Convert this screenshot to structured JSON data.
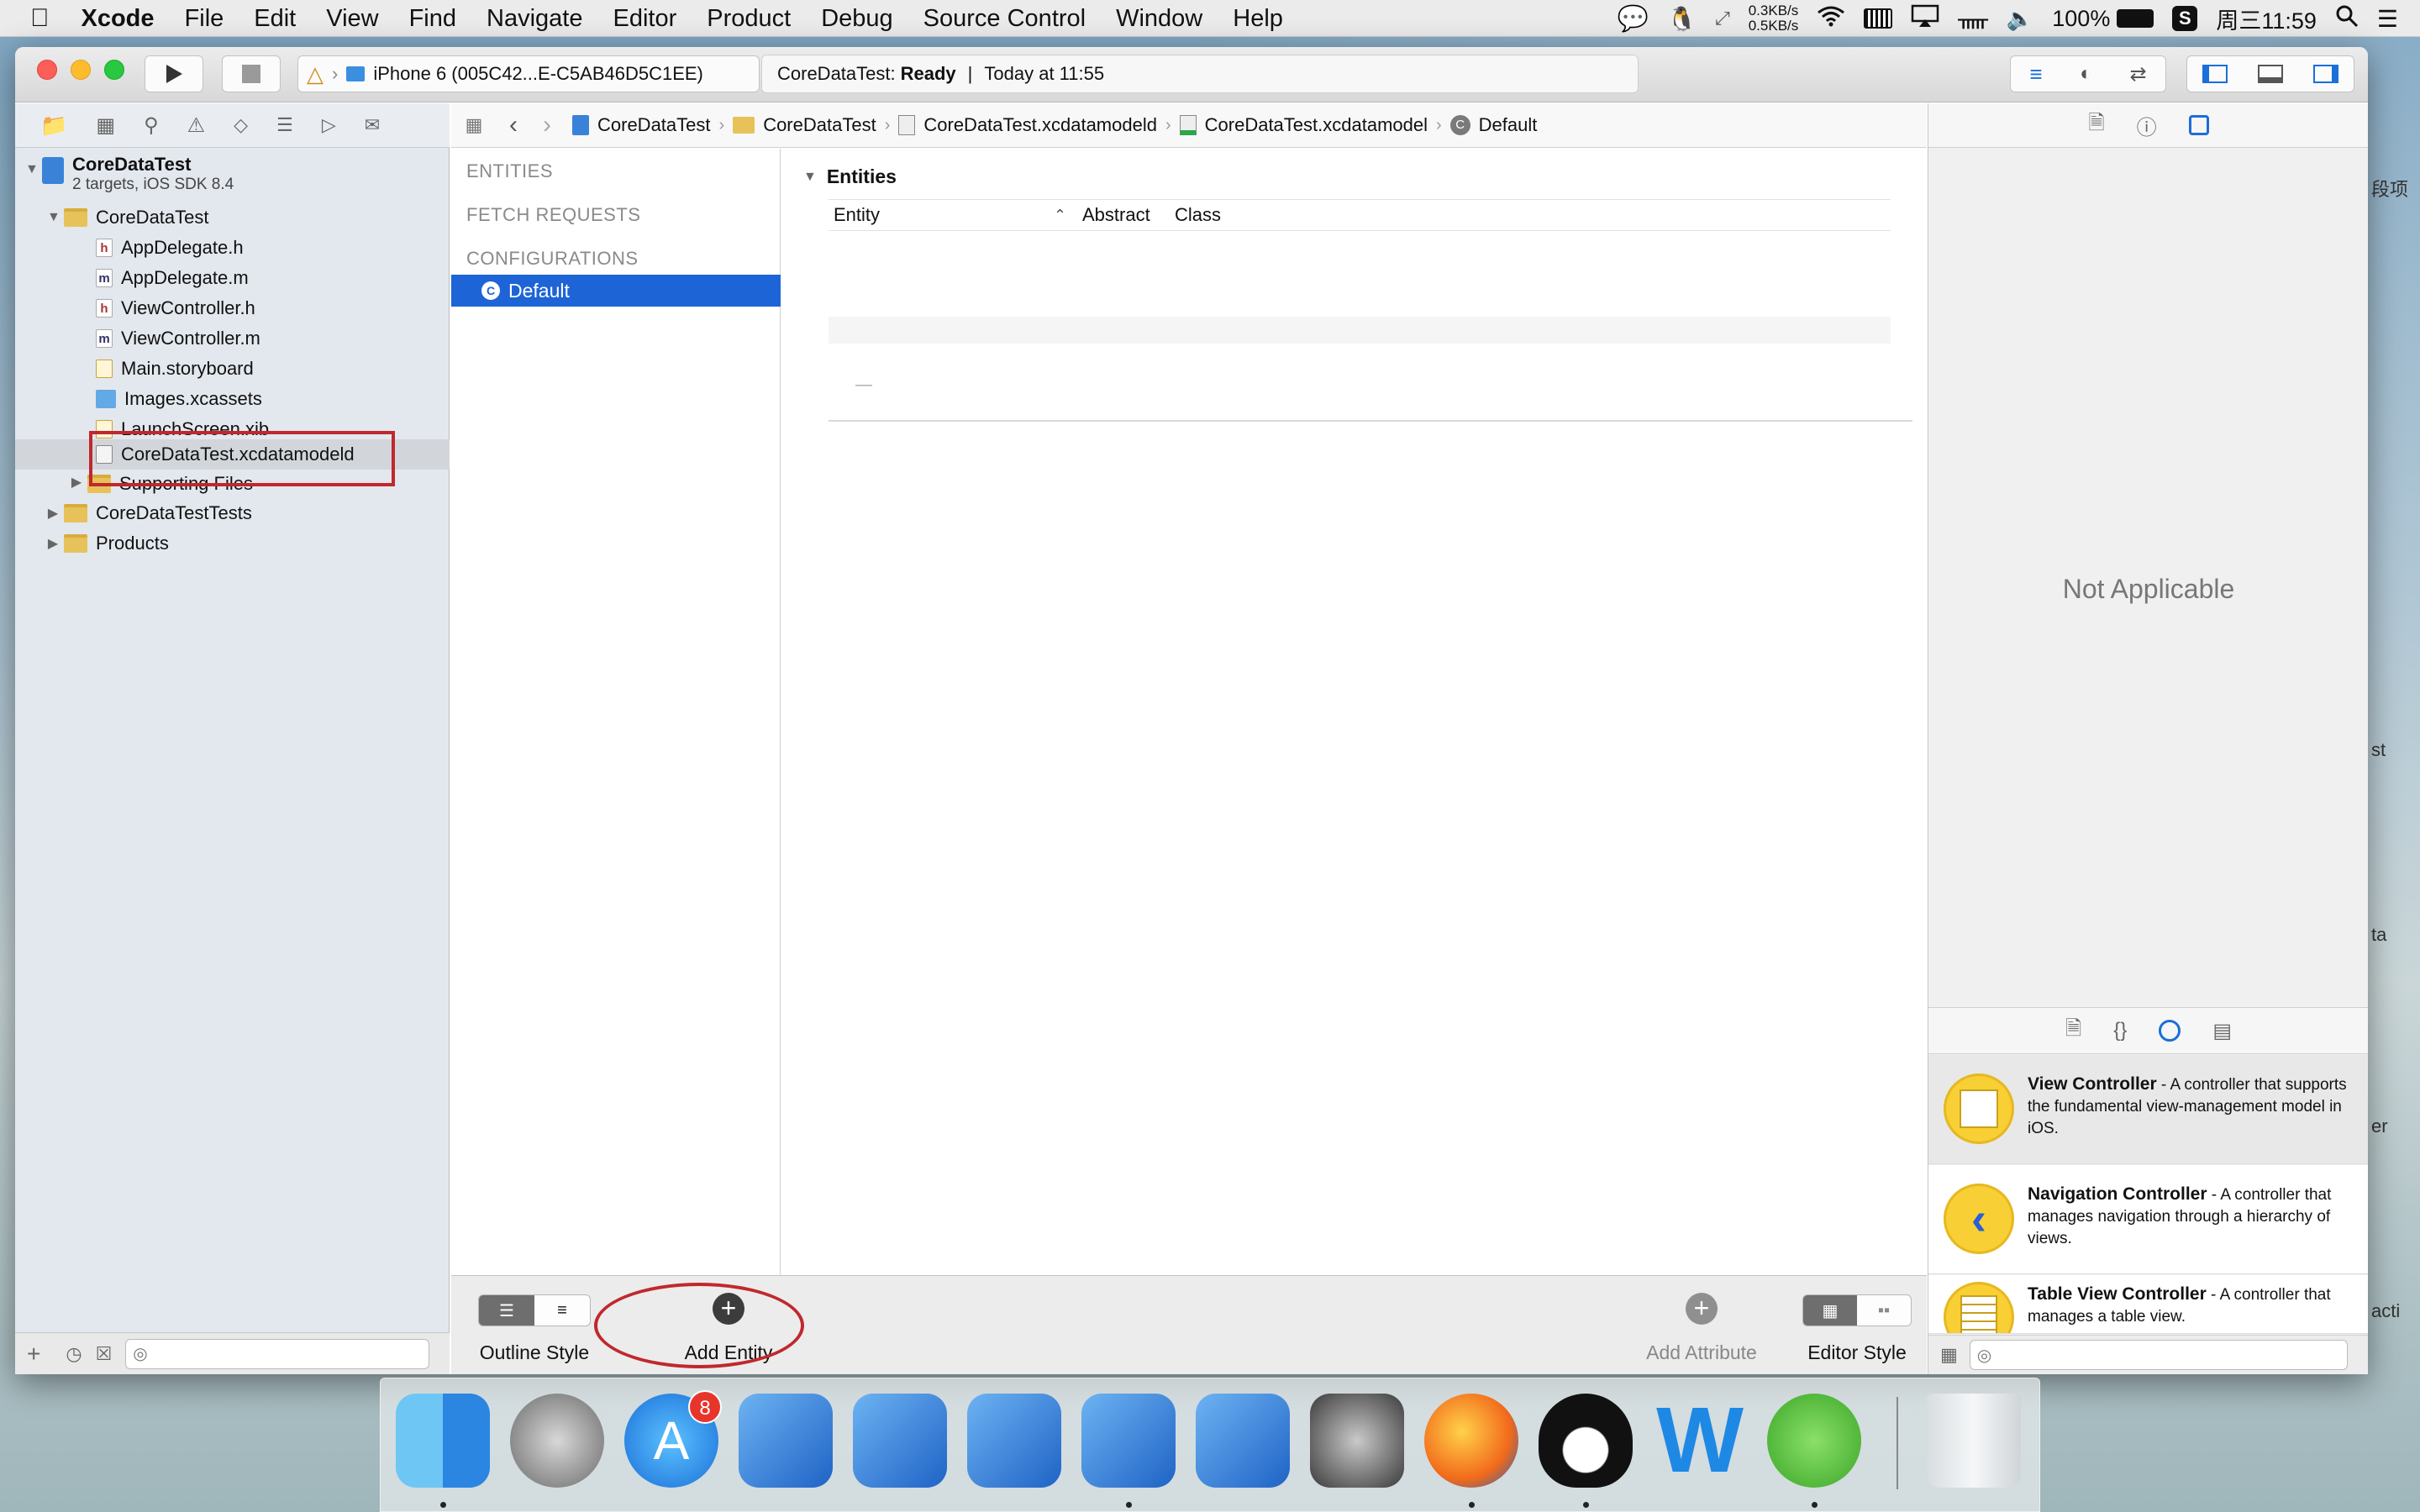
{
  "menubar": {
    "app_name": "Xcode",
    "items": [
      "File",
      "Edit",
      "View",
      "Find",
      "Navigate",
      "Editor",
      "Product",
      "Debug",
      "Source Control",
      "Window",
      "Help"
    ],
    "net_up": "0.3KB/s",
    "net_down": "0.5KB/s",
    "battery": "100%",
    "clock": "周三11:59"
  },
  "toolbar": {
    "scheme_device": "iPhone 6 (005C42...E-C5AB46D5C1EE)",
    "status_project": "CoreDataTest:",
    "status_state": "Ready",
    "status_divider": "|",
    "status_time": "Today at 11:55"
  },
  "navigator": {
    "project_name": "CoreDataTest",
    "project_sub": "2 targets, iOS SDK 8.4",
    "group_main": "CoreDataTest",
    "files": [
      {
        "name": "AppDelegate.h",
        "type": "h"
      },
      {
        "name": "AppDelegate.m",
        "type": "m"
      },
      {
        "name": "ViewController.h",
        "type": "h"
      },
      {
        "name": "ViewController.m",
        "type": "m"
      },
      {
        "name": "Main.storyboard",
        "type": "sb"
      },
      {
        "name": "Images.xcassets",
        "type": "xa"
      },
      {
        "name": "LaunchScreen.xib",
        "type": "xib"
      },
      {
        "name": "CoreDataTest.xcdatamodeld",
        "type": "dm"
      }
    ],
    "supporting": "Supporting Files",
    "tests_group": "CoreDataTestTests",
    "products_group": "Products"
  },
  "jumpbar": {
    "crumbs": [
      "CoreDataTest",
      "CoreDataTest",
      "CoreDataTest.xcdatamodeld",
      "CoreDataTest.xcdatamodel",
      "Default"
    ]
  },
  "outline": {
    "entities": "ENTITIES",
    "fetch_requests": "FETCH REQUESTS",
    "configurations": "CONFIGURATIONS",
    "selected": "Default"
  },
  "editor": {
    "section_title": "Entities",
    "col_entity": "Entity",
    "col_abstract": "Abstract",
    "col_class": "Class",
    "placeholder_dash": "—"
  },
  "bottom": {
    "outline_style": "Outline Style",
    "add_entity": "Add Entity",
    "add_attribute": "Add Attribute",
    "editor_style": "Editor Style"
  },
  "inspector": {
    "not_applicable": "Not Applicable",
    "library": [
      {
        "title": "View Controller",
        "desc": " - A controller that supports the fundamental view-management model in iOS."
      },
      {
        "title": "Navigation Controller",
        "desc": " - A controller that manages navigation through a hierarchy of views."
      },
      {
        "title": "Table View Controller",
        "desc": " - A controller that manages a table view."
      }
    ]
  },
  "desktop_partial_labels": [
    "段项",
    "st",
    "ta",
    "er",
    "acti"
  ],
  "dock": {
    "badge_app_store": "8",
    "apps": [
      "finder-icon",
      "launchpad-icon",
      "app-store-icon",
      "xcode-icon",
      "xcode-icon",
      "xcode-icon",
      "xcode-icon",
      "xcode-beta-icon",
      "system-preferences-icon",
      "firefox-icon",
      "qq-icon",
      "word-icon",
      "wechat-icon",
      "trash-icon"
    ]
  },
  "colors": {
    "selection": "#1d64d6",
    "highlight_box": "#c0282d",
    "library_yellow": "#f8cf34"
  }
}
